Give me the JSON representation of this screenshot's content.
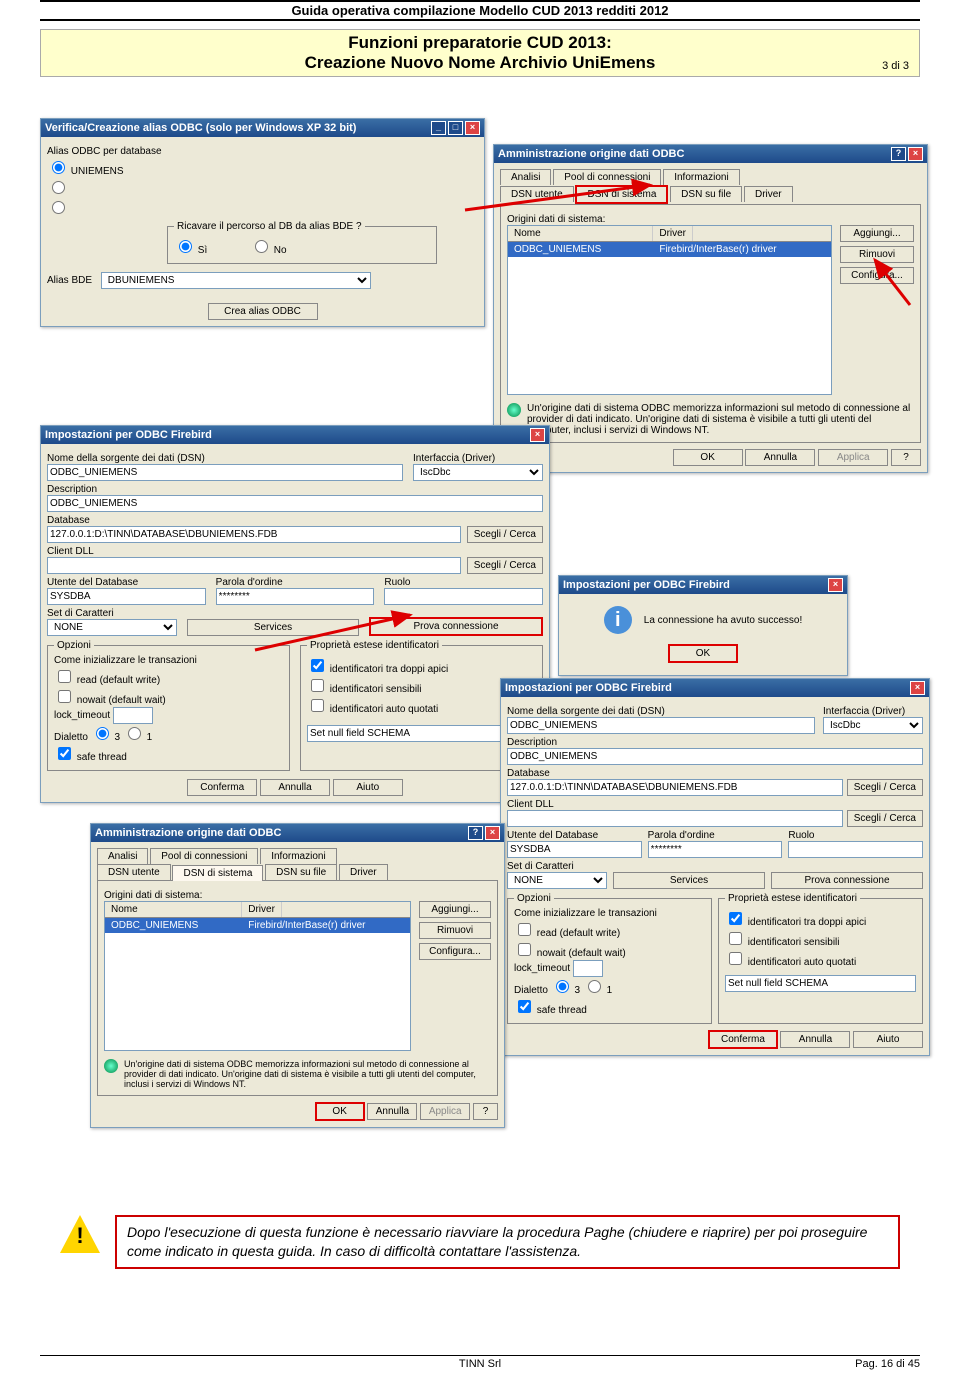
{
  "header": {
    "title": "Guida operativa compilazione Modello CUD 2013 redditi 2012"
  },
  "titleBox": {
    "line1": "Funzioni preparatorie CUD 2013:",
    "line2": "Creazione Nuovo Nome Archivio UniEmens",
    "pageOf": "3 di 3"
  },
  "verifica": {
    "title": "Verifica/Creazione alias ODBC (solo per Windows XP 32 bit)",
    "aliasPerDb": "Alias ODBC per database",
    "opt1": "UNIEMENS",
    "ricavare": "Ricavare il percorso al DB da alias BDE ?",
    "si": "Sì",
    "no": "No",
    "aliasBde": "Alias BDE",
    "aliasBdeVal": "DBUNIEMENS",
    "crea": "Crea alias ODBC"
  },
  "admin": {
    "title": "Amministrazione origine dati ODBC",
    "tabs": {
      "analisi": "Analisi",
      "pool": "Pool di connessioni",
      "info": "Informazioni",
      "dsnUtente": "DSN utente",
      "dsnSistema": "DSN di sistema",
      "dsnFile": "DSN su file",
      "driver": "Driver"
    },
    "origini": "Origini dati di sistema:",
    "colNome": "Nome",
    "colDriver": "Driver",
    "rowName": "ODBC_UNIEMENS",
    "rowDriver": "Firebird/InterBase(r) driver",
    "aggiungi": "Aggiungi...",
    "rimuovi": "Rimuovi",
    "configura": "Configura...",
    "hint": "Un'origine dati di sistema ODBC memorizza informazioni sul metodo di connessione al provider di dati indicato. Un'origine dati di sistema è visibile a tutti gli utenti del computer, inclusi i servizi di Windows NT.",
    "ok": "OK",
    "annulla": "Annulla",
    "applica": "Applica",
    "help": "?"
  },
  "firebird": {
    "title": "Impostazioni per ODBC Firebird",
    "lbl_dsn": "Nome della sorgente dei dati (DSN)",
    "val_dsn": "ODBC_UNIEMENS",
    "lbl_iface": "Interfaccia (Driver)",
    "val_iface": "IscDbc",
    "lbl_desc": "Description",
    "val_desc": "ODBC_UNIEMENS",
    "lbl_db": "Database",
    "val_db": "127.0.0.1:D:\\TINN\\DATABASE\\DBUNIEMENS.FDB",
    "scegli": "Scegli / Cerca",
    "lbl_client": "Client DLL",
    "lbl_user": "Utente del Database",
    "val_user": "SYSDBA",
    "lbl_pass": "Parola d'ordine",
    "val_pass": "********",
    "lbl_ruolo": "Ruolo",
    "lbl_set": "Set di Caratteri",
    "val_set": "NONE",
    "services": "Services",
    "prova": "Prova connessione",
    "opzioni": "Opzioni",
    "trans": "Come inizializzare le transazioni",
    "read": "read (default write)",
    "nowait": "nowait (default wait)",
    "lock": "lock_timeout",
    "dialetto": "Dialetto",
    "d3": "3",
    "d1": "1",
    "safe": "safe thread",
    "prop": "Proprietà estese identificatori",
    "doppi": "identificatori tra doppi apici",
    "sensibili": "identificatori sensibili",
    "quotati": "identificatori auto quotati",
    "schema": "Set null field SCHEMA",
    "conferma": "Conferma",
    "annulla": "Annulla",
    "aiuto": "Aiuto"
  },
  "successo": {
    "title": "Impostazioni per ODBC Firebird",
    "msg": "La connessione ha avuto successo!",
    "ok": "OK"
  },
  "warning": {
    "text": "Dopo l'esecuzione di questa funzione è necessario riavviare la procedura Paghe (chiudere e riaprire) per poi proseguire come indicato in questa guida. In caso di difficoltà contattare l'assistenza."
  },
  "footer": {
    "left": "TINN Srl",
    "right": "Pag. 16 di 45"
  }
}
